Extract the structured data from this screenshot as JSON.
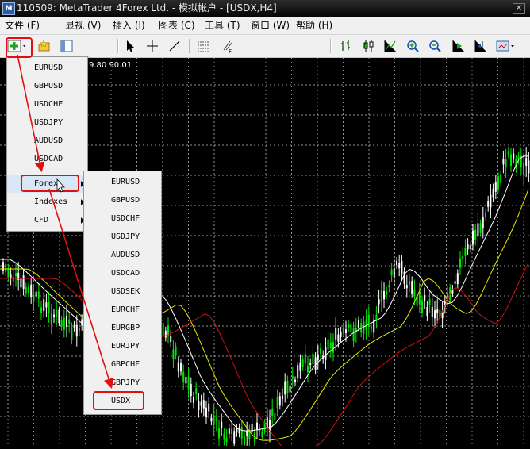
{
  "window": {
    "title": "110509: MetaTrader 4Forex Ltd. - 模拟帐户 - [USDX,H4]"
  },
  "menubar": {
    "items": [
      "文件 (F)",
      "显视 (V)",
      "插入 (I)",
      "图表 (C)",
      "工具 (T)",
      "窗口 (W)",
      "帮助 (H)"
    ]
  },
  "toolbar": {
    "icons": [
      "new-chart-icon",
      "profiles-icon",
      "market-watch-icon",
      "cursor-icon",
      "crosshair-icon",
      "trendline-icon",
      "periods-icon",
      "text-icon",
      "bar-chart-icon",
      "candlestick-icon",
      "line-chart-icon",
      "zoom-in-icon",
      "zoom-out-icon",
      "autoscroll-icon",
      "chart-shift-icon",
      "templates-icon"
    ]
  },
  "chart": {
    "ohlc_readout": "9.80 90.01",
    "colors": {
      "background": "#000000",
      "grid": "#cfcfcf",
      "bull": "#00e600",
      "bear": "#ffffff",
      "ma_fast": "#ffffff",
      "ma_mid": "#e8e800",
      "ma_slow": "#d01010"
    }
  },
  "menu_symbols": {
    "items": [
      "EURUSD",
      "GBPUSD",
      "USDCHF",
      "USDJPY",
      "AUDUSD",
      "USDCAD"
    ],
    "groups": [
      "Forex",
      "Indexes",
      "CFD"
    ],
    "highlighted": "Forex"
  },
  "menu_forex": {
    "items": [
      "EURUSD",
      "GBPUSD",
      "USDCHF",
      "USDJPY",
      "AUDUSD",
      "USDCAD",
      "USDSEK",
      "EURCHF",
      "EURGBP",
      "EURJPY",
      "GBPCHF",
      "GBPJPY",
      "USDX"
    ],
    "highlighted": "USDX"
  },
  "annotation": {
    "color": "#e01010"
  }
}
